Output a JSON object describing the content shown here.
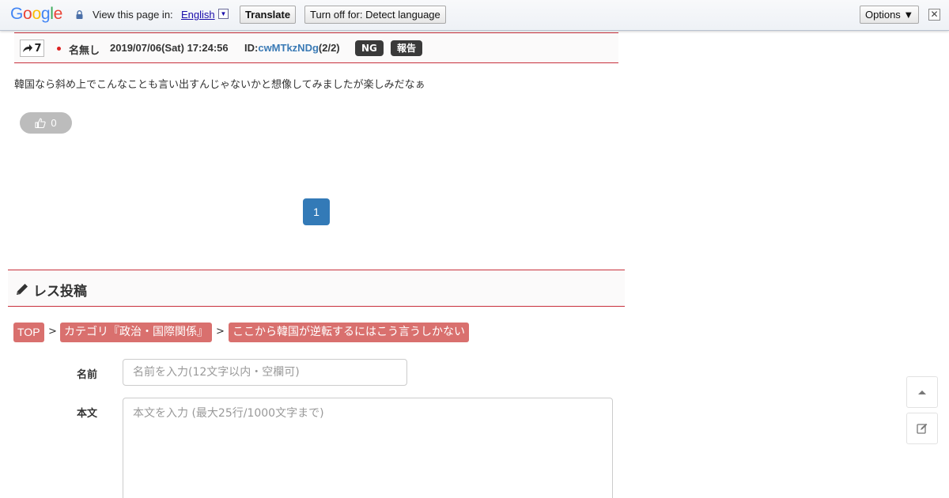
{
  "translate_bar": {
    "logo": "Google",
    "prompt": "View this page in:",
    "language": "English",
    "translate_label": "Translate",
    "turn_off_label": "Turn off for: Detect language",
    "options_label": "Options ▼",
    "close_glyph": "✕",
    "caret_glyph": "▼"
  },
  "post": {
    "res_number": "7",
    "name": "名無し",
    "date": "2019/07/06(Sat) 17:24:56",
    "id_prefix": "ID:",
    "id_value": "cwMTkzNDg",
    "id_count": "(2/2)",
    "ng_label": "NG",
    "report_label": "報告",
    "body": "韓国なら斜め上でこんなことも言い出すんじゃないかと想像してみましたが楽しみだなぁ",
    "like_count": "0"
  },
  "pagination": {
    "current": "1"
  },
  "reply_section": {
    "title": "レス投稿"
  },
  "breadcrumb": {
    "items": [
      "TOP",
      "カテゴリ『政治・国際関係』",
      "ここから韓国が逆転するにはこう言うしかない"
    ],
    "separator": ">"
  },
  "form": {
    "name_label": "名前",
    "name_placeholder": "名前を入力(12文字以内・空欄可)",
    "body_label": "本文",
    "body_placeholder": "本文を入力 (最大25行/1000文字まで)"
  },
  "colors": {
    "accent_red": "#c8303c",
    "crumb_bg": "#d9706e",
    "page_blue": "#337ab7",
    "id_link": "#3a7ab5"
  },
  "icons": [
    "lock-icon",
    "forward-arrow-icon",
    "thumbs-up-icon",
    "pencil-icon",
    "chevron-up-icon",
    "edit-icon",
    "close-icon"
  ]
}
